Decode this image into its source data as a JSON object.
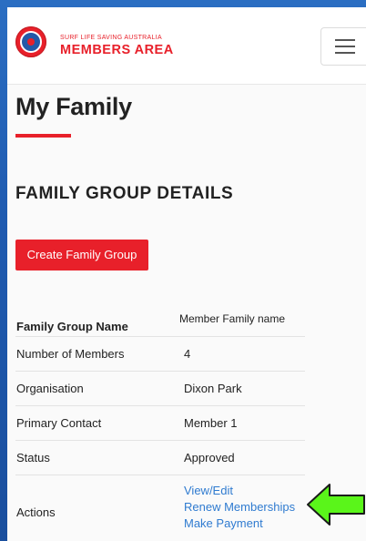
{
  "header": {
    "brand_small": "SURF LIFE SAVING AUSTRALIA",
    "brand_big": "MEMBERS AREA",
    "menu_icon": "hamburger-menu-icon",
    "logo_icon": "surf-life-saving-logo"
  },
  "page": {
    "title": "My Family",
    "section_title": "FAMILY GROUP DETAILS",
    "create_button_label": "Create Family Group"
  },
  "family_table": {
    "rows": [
      {
        "label": "Family Group Name",
        "value": "Member Family name"
      },
      {
        "label": "Number of Members",
        "value": "4"
      },
      {
        "label": "Organisation",
        "value": "Dixon Park"
      },
      {
        "label": "Primary Contact",
        "value": "Member 1"
      },
      {
        "label": "Status",
        "value": "Approved"
      }
    ],
    "actions_label": "Actions",
    "actions": [
      "View/Edit",
      "Renew Memberships",
      "Make Payment"
    ]
  },
  "colors": {
    "brand_red": "#e8202a",
    "link_blue": "#2f7bd0",
    "arrow_green": "#5af51a",
    "background_blue": "#1f5bb0"
  },
  "annotation": {
    "arrow_icon": "green-pointer-arrow-icon"
  }
}
